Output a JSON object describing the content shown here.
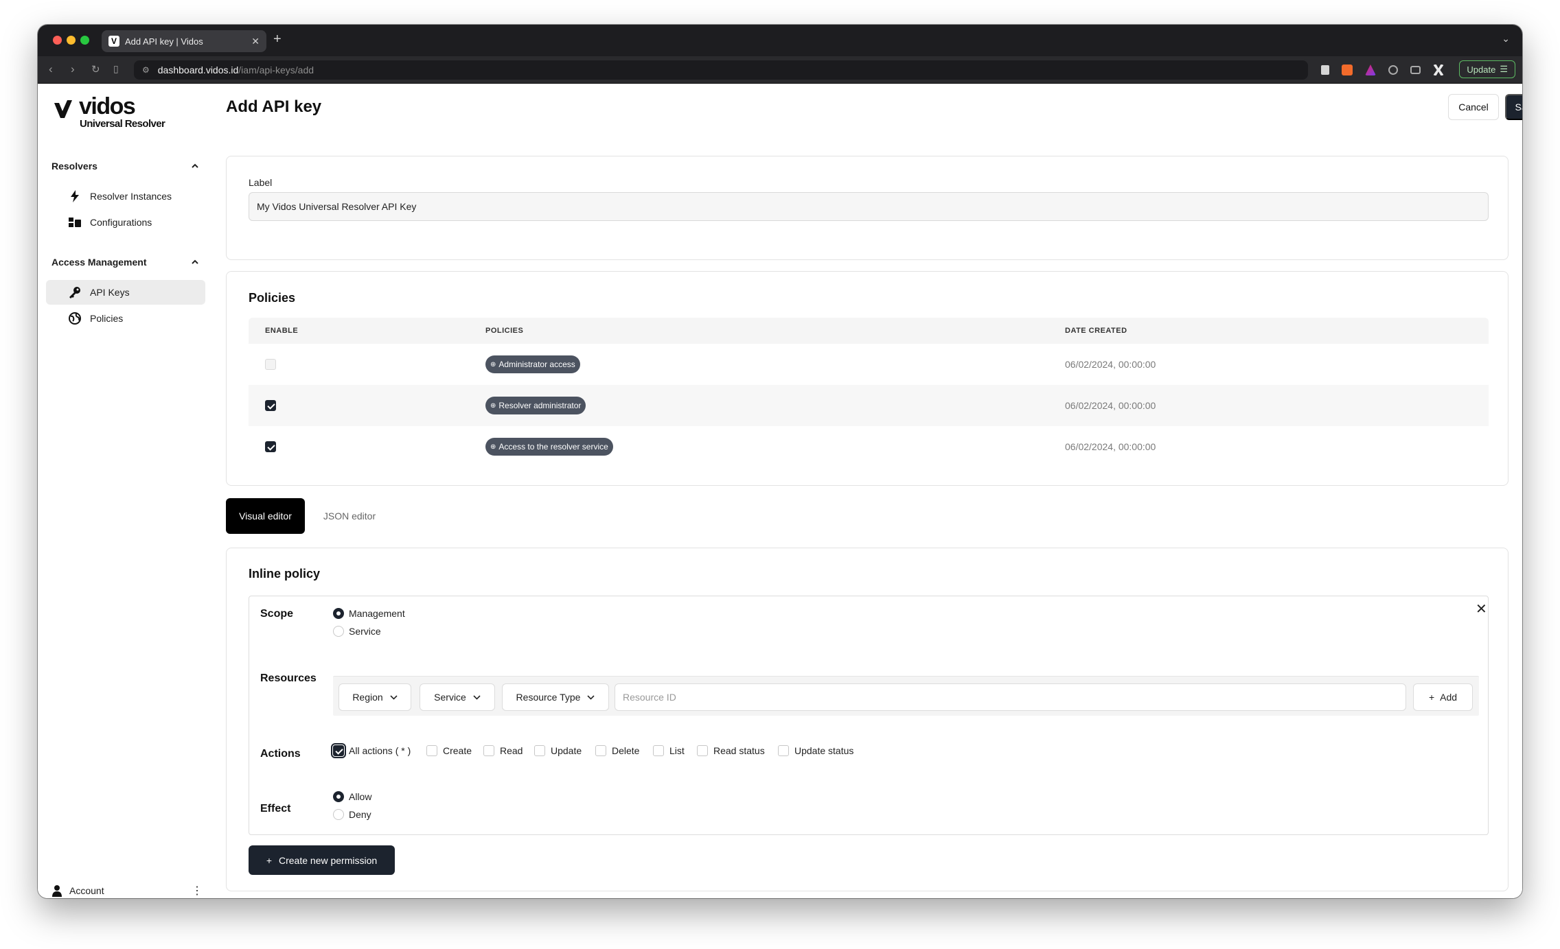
{
  "browser": {
    "tab_title": "Add API key | Vidos",
    "favicon_letter": "V",
    "url_host": "dashboard.vidos.id",
    "url_path": "/iam/api-keys/add",
    "update_label": "Update"
  },
  "sidebar": {
    "logo_word": "vidos",
    "logo_sub": "Universal Resolver",
    "sections": [
      {
        "title": "Resolvers",
        "items": [
          {
            "label": "Resolver Instances",
            "icon": "bolt-icon"
          },
          {
            "label": "Configurations",
            "icon": "config-icon"
          }
        ]
      },
      {
        "title": "Access Management",
        "items": [
          {
            "label": "API Keys",
            "icon": "key-icon",
            "active": true
          },
          {
            "label": "Policies",
            "icon": "globe-icon"
          }
        ]
      }
    ],
    "account_label": "Account"
  },
  "header": {
    "title": "Add API key",
    "cancel_label": "Cancel",
    "save_label": "Save"
  },
  "label_card": {
    "label": "Label",
    "value": "My Vidos Universal Resolver API Key"
  },
  "policies_card": {
    "title": "Policies",
    "columns": [
      "ENABLE",
      "POLICIES",
      "DATE CREATED"
    ],
    "rows": [
      {
        "enabled": false,
        "disabled": true,
        "policy": "Administrator access",
        "date": "06/02/2024, 00:00:00"
      },
      {
        "enabled": true,
        "policy": "Resolver administrator",
        "date": "06/02/2024, 00:00:00"
      },
      {
        "enabled": true,
        "policy": "Access to the resolver service",
        "date": "06/02/2024, 00:00:00"
      }
    ]
  },
  "editor_tabs": {
    "visual": "Visual editor",
    "json": "JSON editor",
    "active": "visual"
  },
  "inline_policy": {
    "title": "Inline policy",
    "scope": {
      "label": "Scope",
      "options": [
        "Management",
        "Service"
      ],
      "selected": "Management"
    },
    "resources": {
      "label": "Resources",
      "region": "Region",
      "service": "Service",
      "resource_type": "Resource Type",
      "resource_id_placeholder": "Resource ID",
      "add_label": "Add"
    },
    "actions": {
      "label": "Actions",
      "options": [
        {
          "label": "All actions ( * )",
          "checked": true
        },
        {
          "label": "Create",
          "checked": false
        },
        {
          "label": "Read",
          "checked": false
        },
        {
          "label": "Update",
          "checked": false
        },
        {
          "label": "Delete",
          "checked": false
        },
        {
          "label": "List",
          "checked": false
        },
        {
          "label": "Read status",
          "checked": false
        },
        {
          "label": "Update status",
          "checked": false
        }
      ]
    },
    "effect": {
      "label": "Effect",
      "options": [
        "Allow",
        "Deny"
      ],
      "selected": "Allow"
    },
    "create_button": "Create new permission"
  },
  "colors": {
    "primary": "#1c232e",
    "pill": "#4c5360",
    "chrome": "#1d1d20"
  }
}
